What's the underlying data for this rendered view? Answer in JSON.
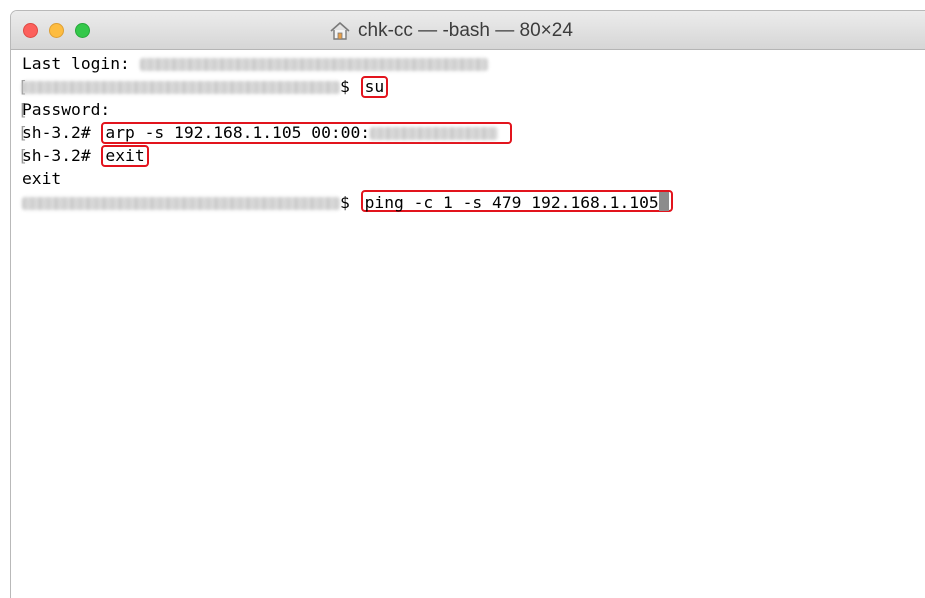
{
  "window": {
    "title": "chk-cc — -bash — 80×24",
    "icon": "home-icon"
  },
  "terminal": {
    "line1_label": "Last login: ",
    "prompt_symbol": "$ ",
    "cmd_su": "su",
    "password_label": "Password:",
    "root_prompt": "sh-3.2# ",
    "cmd_arp": "arp -s 192.168.1.105 00:00:",
    "cmd_exit": "exit",
    "exit_output": "exit",
    "cmd_ping": "ping -c 1 -s 479 192.168.1.105"
  },
  "colors": {
    "highlight_border": "#e2141d",
    "close": "#fc605c",
    "minimize": "#fdbc40",
    "zoom": "#34c84a"
  }
}
